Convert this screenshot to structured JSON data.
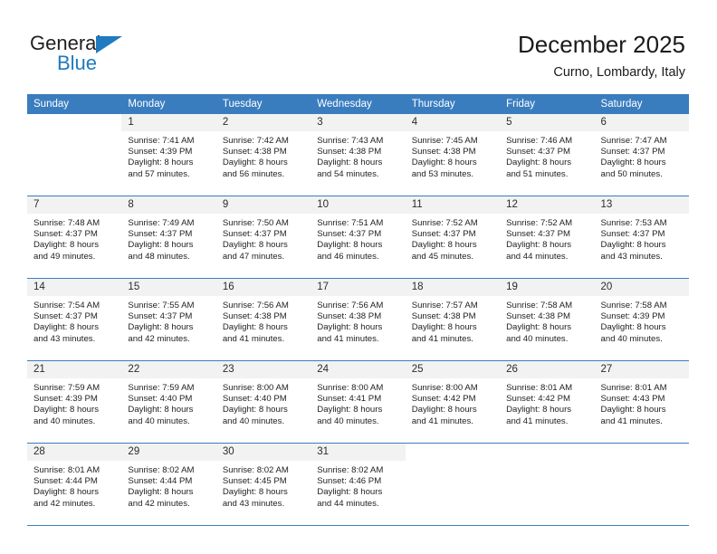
{
  "logo": {
    "text_primary": "General",
    "text_secondary": "Blue",
    "primary_color": "#231f20",
    "secondary_color": "#1f7ac0"
  },
  "header": {
    "title": "December 2025",
    "subtitle": "Curno, Lombardy, Italy"
  },
  "theme": {
    "header_bar_color": "#3a7dbf",
    "daynum_bg": "#f2f2f2",
    "grid_line_color": "#3a7dbf"
  },
  "weekday_headers": [
    "Sunday",
    "Monday",
    "Tuesday",
    "Wednesday",
    "Thursday",
    "Friday",
    "Saturday"
  ],
  "weeks": [
    [
      {
        "day": "",
        "sunrise": "",
        "sunset": "",
        "daylight_line1": "",
        "daylight_line2": ""
      },
      {
        "day": "1",
        "sunrise": "Sunrise: 7:41 AM",
        "sunset": "Sunset: 4:39 PM",
        "daylight_line1": "Daylight: 8 hours",
        "daylight_line2": "and 57 minutes."
      },
      {
        "day": "2",
        "sunrise": "Sunrise: 7:42 AM",
        "sunset": "Sunset: 4:38 PM",
        "daylight_line1": "Daylight: 8 hours",
        "daylight_line2": "and 56 minutes."
      },
      {
        "day": "3",
        "sunrise": "Sunrise: 7:43 AM",
        "sunset": "Sunset: 4:38 PM",
        "daylight_line1": "Daylight: 8 hours",
        "daylight_line2": "and 54 minutes."
      },
      {
        "day": "4",
        "sunrise": "Sunrise: 7:45 AM",
        "sunset": "Sunset: 4:38 PM",
        "daylight_line1": "Daylight: 8 hours",
        "daylight_line2": "and 53 minutes."
      },
      {
        "day": "5",
        "sunrise": "Sunrise: 7:46 AM",
        "sunset": "Sunset: 4:37 PM",
        "daylight_line1": "Daylight: 8 hours",
        "daylight_line2": "and 51 minutes."
      },
      {
        "day": "6",
        "sunrise": "Sunrise: 7:47 AM",
        "sunset": "Sunset: 4:37 PM",
        "daylight_line1": "Daylight: 8 hours",
        "daylight_line2": "and 50 minutes."
      }
    ],
    [
      {
        "day": "7",
        "sunrise": "Sunrise: 7:48 AM",
        "sunset": "Sunset: 4:37 PM",
        "daylight_line1": "Daylight: 8 hours",
        "daylight_line2": "and 49 minutes."
      },
      {
        "day": "8",
        "sunrise": "Sunrise: 7:49 AM",
        "sunset": "Sunset: 4:37 PM",
        "daylight_line1": "Daylight: 8 hours",
        "daylight_line2": "and 48 minutes."
      },
      {
        "day": "9",
        "sunrise": "Sunrise: 7:50 AM",
        "sunset": "Sunset: 4:37 PM",
        "daylight_line1": "Daylight: 8 hours",
        "daylight_line2": "and 47 minutes."
      },
      {
        "day": "10",
        "sunrise": "Sunrise: 7:51 AM",
        "sunset": "Sunset: 4:37 PM",
        "daylight_line1": "Daylight: 8 hours",
        "daylight_line2": "and 46 minutes."
      },
      {
        "day": "11",
        "sunrise": "Sunrise: 7:52 AM",
        "sunset": "Sunset: 4:37 PM",
        "daylight_line1": "Daylight: 8 hours",
        "daylight_line2": "and 45 minutes."
      },
      {
        "day": "12",
        "sunrise": "Sunrise: 7:52 AM",
        "sunset": "Sunset: 4:37 PM",
        "daylight_line1": "Daylight: 8 hours",
        "daylight_line2": "and 44 minutes."
      },
      {
        "day": "13",
        "sunrise": "Sunrise: 7:53 AM",
        "sunset": "Sunset: 4:37 PM",
        "daylight_line1": "Daylight: 8 hours",
        "daylight_line2": "and 43 minutes."
      }
    ],
    [
      {
        "day": "14",
        "sunrise": "Sunrise: 7:54 AM",
        "sunset": "Sunset: 4:37 PM",
        "daylight_line1": "Daylight: 8 hours",
        "daylight_line2": "and 43 minutes."
      },
      {
        "day": "15",
        "sunrise": "Sunrise: 7:55 AM",
        "sunset": "Sunset: 4:37 PM",
        "daylight_line1": "Daylight: 8 hours",
        "daylight_line2": "and 42 minutes."
      },
      {
        "day": "16",
        "sunrise": "Sunrise: 7:56 AM",
        "sunset": "Sunset: 4:38 PM",
        "daylight_line1": "Daylight: 8 hours",
        "daylight_line2": "and 41 minutes."
      },
      {
        "day": "17",
        "sunrise": "Sunrise: 7:56 AM",
        "sunset": "Sunset: 4:38 PM",
        "daylight_line1": "Daylight: 8 hours",
        "daylight_line2": "and 41 minutes."
      },
      {
        "day": "18",
        "sunrise": "Sunrise: 7:57 AM",
        "sunset": "Sunset: 4:38 PM",
        "daylight_line1": "Daylight: 8 hours",
        "daylight_line2": "and 41 minutes."
      },
      {
        "day": "19",
        "sunrise": "Sunrise: 7:58 AM",
        "sunset": "Sunset: 4:38 PM",
        "daylight_line1": "Daylight: 8 hours",
        "daylight_line2": "and 40 minutes."
      },
      {
        "day": "20",
        "sunrise": "Sunrise: 7:58 AM",
        "sunset": "Sunset: 4:39 PM",
        "daylight_line1": "Daylight: 8 hours",
        "daylight_line2": "and 40 minutes."
      }
    ],
    [
      {
        "day": "21",
        "sunrise": "Sunrise: 7:59 AM",
        "sunset": "Sunset: 4:39 PM",
        "daylight_line1": "Daylight: 8 hours",
        "daylight_line2": "and 40 minutes."
      },
      {
        "day": "22",
        "sunrise": "Sunrise: 7:59 AM",
        "sunset": "Sunset: 4:40 PM",
        "daylight_line1": "Daylight: 8 hours",
        "daylight_line2": "and 40 minutes."
      },
      {
        "day": "23",
        "sunrise": "Sunrise: 8:00 AM",
        "sunset": "Sunset: 4:40 PM",
        "daylight_line1": "Daylight: 8 hours",
        "daylight_line2": "and 40 minutes."
      },
      {
        "day": "24",
        "sunrise": "Sunrise: 8:00 AM",
        "sunset": "Sunset: 4:41 PM",
        "daylight_line1": "Daylight: 8 hours",
        "daylight_line2": "and 40 minutes."
      },
      {
        "day": "25",
        "sunrise": "Sunrise: 8:00 AM",
        "sunset": "Sunset: 4:42 PM",
        "daylight_line1": "Daylight: 8 hours",
        "daylight_line2": "and 41 minutes."
      },
      {
        "day": "26",
        "sunrise": "Sunrise: 8:01 AM",
        "sunset": "Sunset: 4:42 PM",
        "daylight_line1": "Daylight: 8 hours",
        "daylight_line2": "and 41 minutes."
      },
      {
        "day": "27",
        "sunrise": "Sunrise: 8:01 AM",
        "sunset": "Sunset: 4:43 PM",
        "daylight_line1": "Daylight: 8 hours",
        "daylight_line2": "and 41 minutes."
      }
    ],
    [
      {
        "day": "28",
        "sunrise": "Sunrise: 8:01 AM",
        "sunset": "Sunset: 4:44 PM",
        "daylight_line1": "Daylight: 8 hours",
        "daylight_line2": "and 42 minutes."
      },
      {
        "day": "29",
        "sunrise": "Sunrise: 8:02 AM",
        "sunset": "Sunset: 4:44 PM",
        "daylight_line1": "Daylight: 8 hours",
        "daylight_line2": "and 42 minutes."
      },
      {
        "day": "30",
        "sunrise": "Sunrise: 8:02 AM",
        "sunset": "Sunset: 4:45 PM",
        "daylight_line1": "Daylight: 8 hours",
        "daylight_line2": "and 43 minutes."
      },
      {
        "day": "31",
        "sunrise": "Sunrise: 8:02 AM",
        "sunset": "Sunset: 4:46 PM",
        "daylight_line1": "Daylight: 8 hours",
        "daylight_line2": "and 44 minutes."
      },
      {
        "day": "",
        "sunrise": "",
        "sunset": "",
        "daylight_line1": "",
        "daylight_line2": ""
      },
      {
        "day": "",
        "sunrise": "",
        "sunset": "",
        "daylight_line1": "",
        "daylight_line2": ""
      },
      {
        "day": "",
        "sunrise": "",
        "sunset": "",
        "daylight_line1": "",
        "daylight_line2": ""
      }
    ]
  ]
}
